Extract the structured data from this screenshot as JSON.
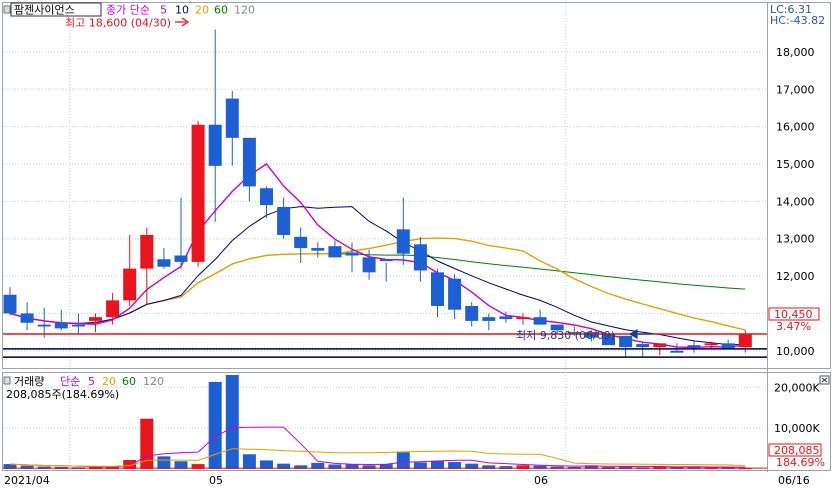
{
  "header": {
    "stock_name": "팜젠사이언스",
    "price_ma_label": "종가 단순",
    "ma_periods": [
      "5",
      "10",
      "20",
      "60",
      "120"
    ],
    "ma_colors": [
      "#cc00cc",
      "#000080",
      "#e8a000",
      "#008000",
      "#888888"
    ],
    "high_note": "최고 18,600 (04/30)",
    "low_note": "최저 9,830 (06/09)",
    "lc_label": "LC:6.31",
    "hc_label": "HC:-43.82",
    "volume_label": "거래량",
    "volume_ma_label": "단순",
    "volume_readout": "208,085주(184.69%)"
  },
  "price_axis": {
    "ticks": [
      "18,000",
      "17,000",
      "16,000",
      "15,000",
      "14,000",
      "13,000",
      "12,000",
      "11,000",
      "10,000"
    ],
    "ylim": [
      9700,
      18800
    ],
    "current_price": "10,450",
    "current_change": "3.47%"
  },
  "volume_axis": {
    "ticks": [
      "20,000K",
      "10,000K"
    ],
    "ylim": [
      0,
      23000
    ],
    "current_volume": "208,085",
    "current_ratio": "184.69%"
  },
  "x_axis": {
    "labels": [
      "2021/04",
      "05",
      "06",
      "06/16"
    ]
  },
  "colors": {
    "up": "#e8141e",
    "down": "#1e5fd1",
    "current_line": "#e8141e",
    "ma5": "#cc00cc",
    "ma10": "#000080",
    "ma20": "#e8a000",
    "ma60": "#008000"
  },
  "chart_data": {
    "type": "candlestick",
    "x": [
      "04/14",
      "04/15",
      "04/16",
      "04/19",
      "04/20",
      "04/21",
      "04/22",
      "04/23",
      "04/26",
      "04/27",
      "04/28",
      "04/29",
      "04/30",
      "05/03",
      "05/04",
      "05/06",
      "05/07",
      "05/10",
      "05/11",
      "05/12",
      "05/13",
      "05/14",
      "05/17",
      "05/18",
      "05/20",
      "05/21",
      "05/24",
      "05/25",
      "05/26",
      "05/27",
      "05/28",
      "05/31",
      "06/01",
      "06/02",
      "06/03",
      "06/04",
      "06/07",
      "06/08",
      "06/09",
      "06/10",
      "06/11",
      "06/14",
      "06/15",
      "06/16"
    ],
    "open": [
      11500,
      11000,
      10700,
      10750,
      10700,
      10800,
      10900,
      11350,
      12200,
      12450,
      12550,
      12380,
      16050,
      16750,
      15700,
      14350,
      13850,
      13050,
      12750,
      12800,
      12630,
      12500,
      12450,
      13250,
      12850,
      12100,
      11930,
      11200,
      10900,
      10920,
      10850,
      10900,
      10700,
      10500,
      10500,
      10450,
      10400,
      10180,
      10100,
      10000,
      10150,
      10150,
      10200,
      10100
    ],
    "high": [
      11700,
      11300,
      11150,
      11100,
      11000,
      11000,
      11550,
      13100,
      13300,
      12750,
      14100,
      16150,
      18600,
      16950,
      15700,
      14400,
      14100,
      13300,
      12900,
      12950,
      12900,
      12700,
      12350,
      14100,
      13050,
      12200,
      12050,
      11300,
      11000,
      11050,
      11000,
      11100,
      10700,
      10650,
      10550,
      10450,
      10400,
      10250,
      10100,
      10200,
      10250,
      10250,
      10300,
      10550
    ],
    "low": [
      10950,
      10550,
      10350,
      10550,
      10450,
      10500,
      10700,
      11200,
      11250,
      12200,
      12200,
      12250,
      13450,
      14950,
      14000,
      13550,
      13000,
      12350,
      12500,
      12650,
      12100,
      11900,
      11850,
      12300,
      11850,
      10900,
      10850,
      10650,
      10550,
      10750,
      10700,
      10700,
      10450,
      10400,
      10250,
      10200,
      9830,
      9850,
      9880,
      9950,
      9950,
      10050,
      10050,
      9950
    ],
    "close": [
      11000,
      10750,
      10650,
      10600,
      10650,
      10900,
      11350,
      12200,
      13100,
      12250,
      12380,
      16050,
      14950,
      15700,
      14400,
      13900,
      13100,
      12750,
      12680,
      12500,
      12550,
      12100,
      12400,
      12600,
      12150,
      11200,
      11100,
      10800,
      10800,
      10850,
      10900,
      10700,
      10550,
      10450,
      10350,
      10150,
      10100,
      10100,
      10200,
      9950,
      10100,
      10200,
      10050,
      10450
    ],
    "volume": [
      1200,
      800,
      600,
      500,
      400,
      500,
      500,
      2200,
      12300,
      3100,
      1900,
      1200,
      21300,
      23000,
      3600,
      2100,
      1300,
      900,
      1500,
      1100,
      1100,
      900,
      1200,
      4100,
      1600,
      2000,
      1700,
      1300,
      900,
      700,
      900,
      800,
      600,
      500,
      900,
      500,
      700,
      400,
      500,
      500,
      600,
      400,
      500,
      208
    ]
  }
}
